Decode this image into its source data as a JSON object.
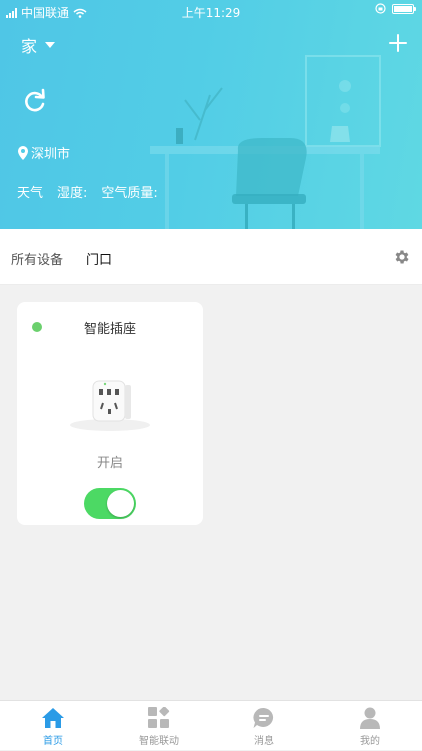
{
  "status_bar": {
    "carrier": "中国联通",
    "time": "上午11:29"
  },
  "header": {
    "home_name": "家",
    "city": "深圳市",
    "weather_label": "天气",
    "humidity_label": "湿度:",
    "air_quality_label": "空气质量:"
  },
  "filter": {
    "all_devices": "所有设备",
    "room": "门口"
  },
  "devices": [
    {
      "name": "智能插座",
      "state": "开启",
      "online": true,
      "on": true
    }
  ],
  "tabbar": {
    "items": [
      {
        "label": "首页",
        "icon": "home-icon",
        "active": true
      },
      {
        "label": "智能联动",
        "icon": "grid-icon",
        "active": false
      },
      {
        "label": "消息",
        "icon": "message-icon",
        "active": false
      },
      {
        "label": "我的",
        "icon": "person-icon",
        "active": false
      }
    ]
  },
  "colors": {
    "accent": "#2b9be6",
    "header": "#52cde6",
    "online": "#6bd06d",
    "toggle_on": "#4cd964"
  }
}
